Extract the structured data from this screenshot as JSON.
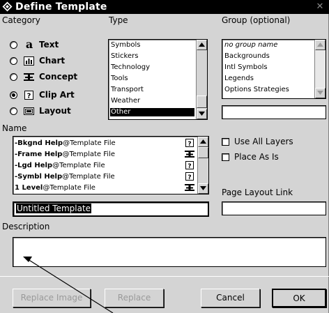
{
  "window": {
    "title": "Define Template",
    "close_icon": "close-icon"
  },
  "category": {
    "label": "Category",
    "options": [
      {
        "glyph": "a",
        "label": "Text",
        "icon": "text-icon",
        "checked": false
      },
      {
        "label": "Chart",
        "icon": "chart-icon",
        "checked": false
      },
      {
        "label": "Concept",
        "icon": "concept-icon",
        "checked": false
      },
      {
        "label": "Clip Art",
        "icon": "clip-art-icon",
        "checked": true
      },
      {
        "label": "Layout",
        "icon": "layout-icon",
        "checked": false
      }
    ]
  },
  "type": {
    "label": "Type",
    "items": [
      "Symbols",
      "Stickers",
      "Technology",
      "Tools",
      "Transport",
      "Weather",
      "Other"
    ],
    "selected": "Other"
  },
  "group": {
    "label": "Group (optional)",
    "items": [
      "no group name",
      "Backgrounds",
      "Intl Symbols",
      "Legends",
      "Options Strategies"
    ],
    "field_value": ""
  },
  "name": {
    "label": "Name",
    "items": [
      {
        "bold": "-Bkgnd Help",
        "rest": "@Template File",
        "icon": "clip-art-icon"
      },
      {
        "bold": "-Frame Help",
        "rest": "@Template File",
        "icon": "concept-icon"
      },
      {
        "bold": "-Lgd Help",
        "rest": "@Template File",
        "icon": "clip-art-icon"
      },
      {
        "bold": "-Symbl Help",
        "rest": "@Template File",
        "icon": "clip-art-icon"
      },
      {
        "bold": "1 Level",
        "rest": "@Template File",
        "icon": "concept-icon"
      }
    ],
    "field_value": "Untitled Template"
  },
  "options": {
    "use_all_layers": {
      "label": "Use All Layers",
      "checked": false
    },
    "place_as_is": {
      "label": "Place As Is",
      "checked": false
    }
  },
  "page_layout_link": {
    "label": "Page Layout Link",
    "value": ""
  },
  "description": {
    "label": "Description",
    "value": ""
  },
  "buttons": {
    "replace_image": "Replace Image",
    "replace": "Replace",
    "cancel": "Cancel",
    "ok": "OK"
  }
}
